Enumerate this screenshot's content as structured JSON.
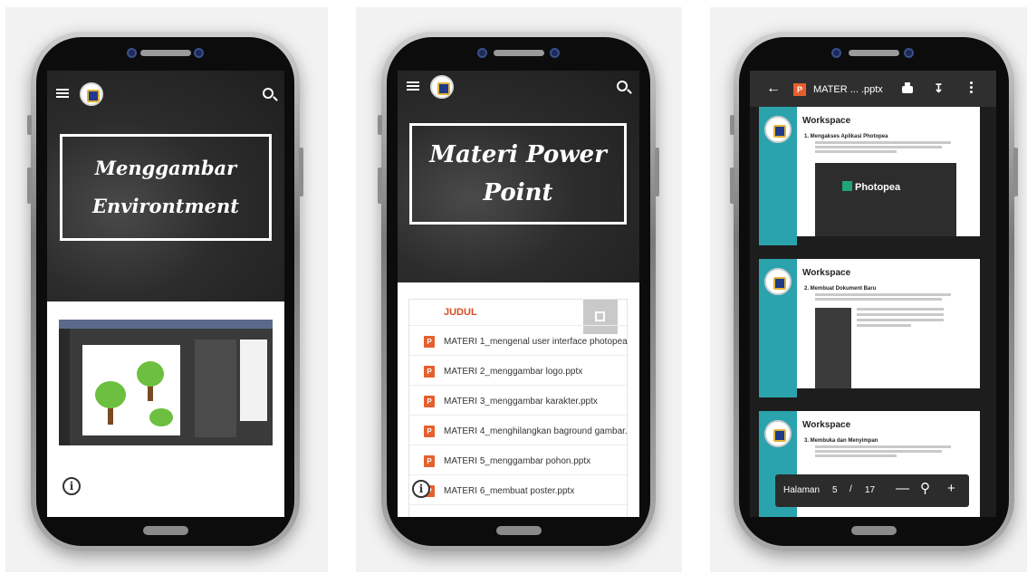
{
  "phone1": {
    "title_line1": "Menggambar",
    "title_line2": "Environtment"
  },
  "phone2": {
    "title_line1": "Materi Power",
    "title_line2": "Point",
    "column_header": "JUDUL",
    "file_icon_letter": "P",
    "files": [
      "MATERI 1_mengenal user interface photopea",
      "MATERI 2_menggambar logo.pptx",
      "MATERI 3_menggambar karakter.pptx",
      "MATERI 4_menghilangkan baground gambar.",
      "MATERI 5_menggambar pohon.pptx",
      "MATERI 6_membuat poster.pptx"
    ]
  },
  "phone3": {
    "doc_title": "MATER ... .pptx",
    "file_icon_letter": "P",
    "slides": [
      {
        "heading": "Workspace",
        "step": "1.   Mengakses Aplikasi Photopea",
        "app_name": "Photopea"
      },
      {
        "heading": "Workspace",
        "step": "2.   Membuat Dokument Baru"
      },
      {
        "heading": "Workspace",
        "step": "3.   Membuka dan Menyimpan"
      }
    ],
    "pager": {
      "label": "Halaman",
      "current": "5",
      "separator": "/",
      "total": "17",
      "zoom_out": "—",
      "zoom_in": "+"
    }
  }
}
